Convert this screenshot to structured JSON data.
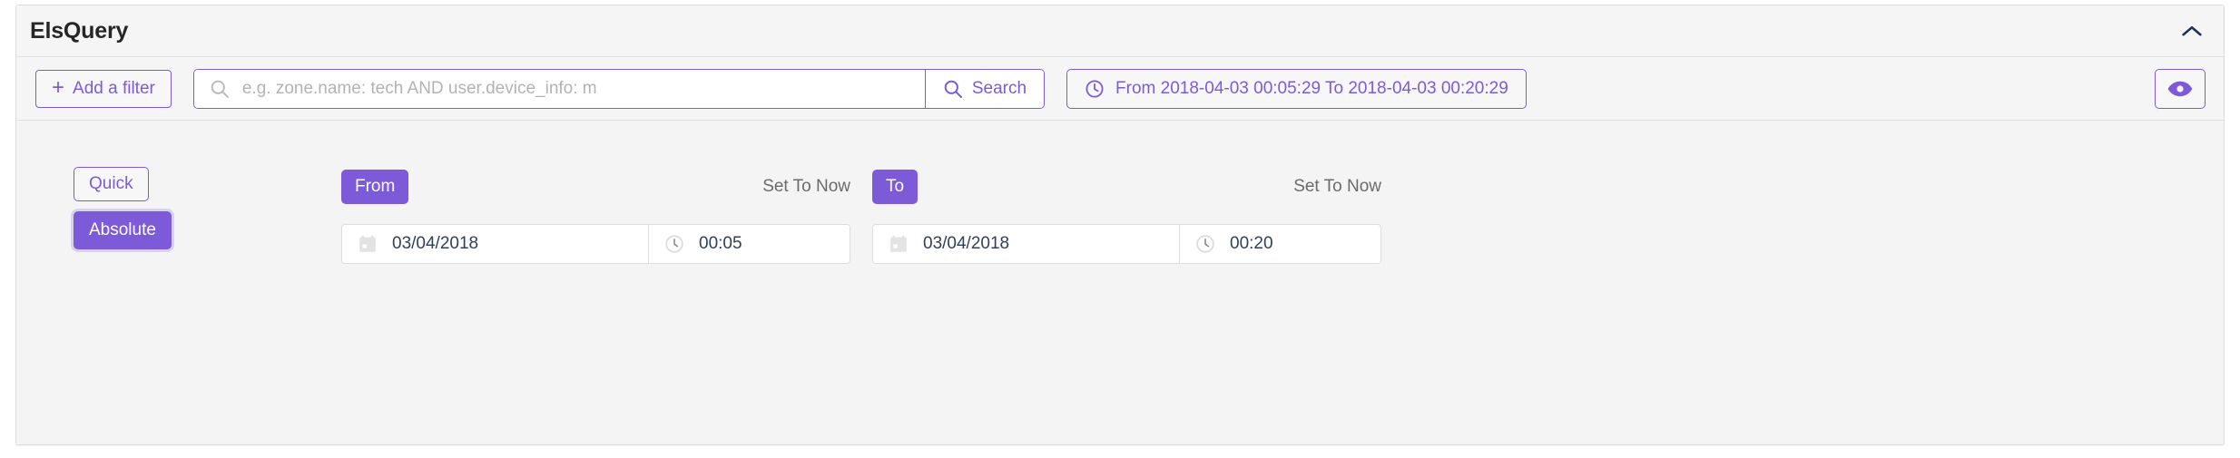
{
  "header": {
    "title": "ElsQuery",
    "collapse_icon": "chevron-up-icon"
  },
  "toolbar": {
    "add_filter_label": "Add a filter",
    "add_filter_icon": "plus-icon",
    "search": {
      "icon": "search-icon",
      "value": "",
      "placeholder": "e.g. zone.name: tech AND user.device_info: m",
      "button_label": "Search",
      "button_icon": "search-icon"
    },
    "daterange": {
      "icon": "clock-icon",
      "label": "From 2018-04-03 00:05:29 To 2018-04-03 00:20:29"
    },
    "visibility_icon": "eye-icon"
  },
  "picker": {
    "modes": {
      "quick_label": "Quick",
      "absolute_label": "Absolute",
      "active": "Absolute"
    },
    "from": {
      "tag_label": "From",
      "set_now_label": "Set To Now",
      "date_icon": "calendar-icon",
      "date_value": "03/04/2018",
      "time_icon": "clock-icon",
      "time_value": "00:05"
    },
    "to": {
      "tag_label": "To",
      "set_now_label": "Set To Now",
      "date_icon": "calendar-icon",
      "date_value": "03/04/2018",
      "time_icon": "clock-icon",
      "time_value": "00:20"
    }
  },
  "colors": {
    "accent": "#7d5ad7",
    "panel_bg": "#f4f4f4",
    "border": "#dcdcdc",
    "text_dark": "#262626",
    "text_muted": "#6b6b6b",
    "field_text": "#31405a"
  }
}
